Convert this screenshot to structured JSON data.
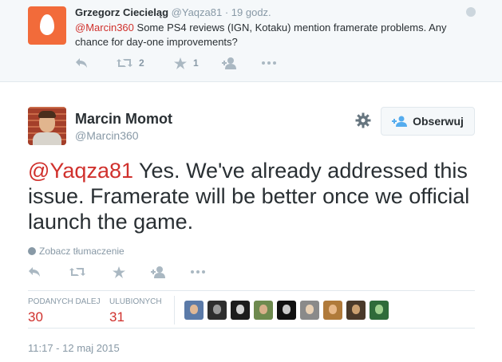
{
  "parent_tweet": {
    "name": "Grzegorz Ciecieląg",
    "handle": "@Yaqza81",
    "time": "· 19 godz.",
    "mention": "@Marcin360",
    "text": " Some PS4 reviews (IGN, Kotaku) mention framerate problems. Any chance for day-one improvements?",
    "retweets": "2",
    "favorites": "1",
    "avatar_color": "#f26b3a"
  },
  "tweet": {
    "name": "Marcin Momot",
    "handle": "@Marcin360",
    "follow_label": "Obserwuj",
    "mention": "@Yaqza81",
    "text": " Yes. We've already addressed this issue. Framerate will be better once we official launch the game.",
    "translate_label": "Zobacz tłumaczenie",
    "retweets_label": "PODANYCH DALEJ",
    "retweets_count": "30",
    "favorites_label": "ULUBIONYCH",
    "favorites_count": "31",
    "timestamp": "11:17 - 12 maj 2015",
    "favoriters_count": 9
  },
  "colors": {
    "mention": "#d0312d",
    "muted": "#8899a6",
    "icon": "#aab8c2",
    "border": "#e1e8ed"
  },
  "icons": [
    "reply-icon",
    "retweet-icon",
    "favorite-icon",
    "follow-icon",
    "more-icon",
    "gear-icon",
    "globe-icon"
  ]
}
